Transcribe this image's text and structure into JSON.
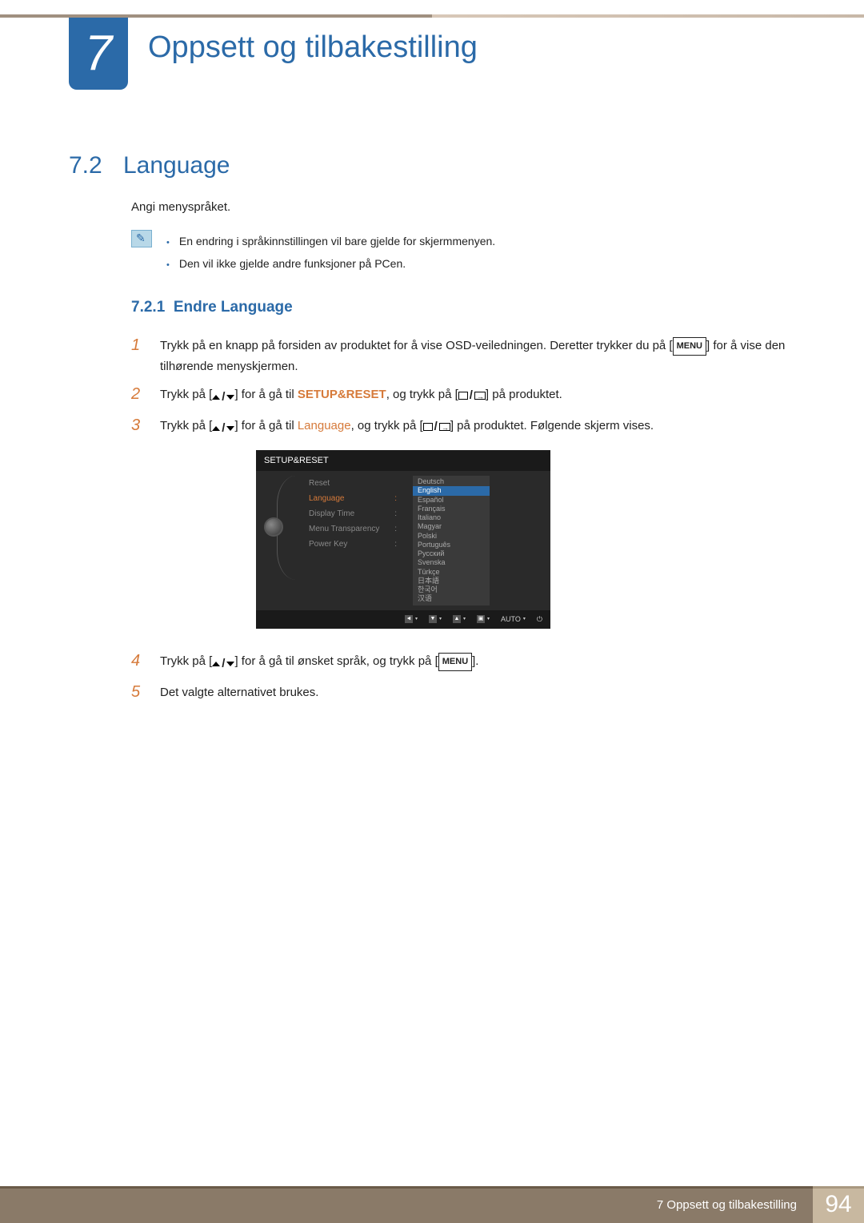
{
  "chapter": {
    "num": "7",
    "title": "Oppsett og tilbakestilling"
  },
  "section": {
    "num": "7.2",
    "title": "Language",
    "intro": "Angi menyspråket.",
    "notes": [
      "En endring i språkinnstillingen vil bare gjelde for skjermmenyen.",
      "Den vil ikke gjelde andre funksjoner på PCen."
    ]
  },
  "subsection": {
    "num": "7.2.1",
    "title": "Endre Language"
  },
  "steps": {
    "s1a": "Trykk på en knapp på forsiden av produktet for å vise OSD-veiledningen. Deretter trykker du på [",
    "s1b": "] for å vise den tilhørende menyskjermen.",
    "s2a": "Trykk på [",
    "s2b": "] for å gå til ",
    "s2c": ", og trykk på [",
    "s2d": "] på produktet.",
    "s3a": "Trykk på [",
    "s3b": "] for å gå til ",
    "s3c": ", og trykk på [",
    "s3d": "] på produktet. Følgende skjerm vises.",
    "s4a": "Trykk på [",
    "s4b": "] for å gå til ønsket språk, og trykk på [",
    "s4c": "].",
    "s5": "Det valgte alternativet brukes."
  },
  "labels": {
    "menu": "MENU",
    "setupreset": "SETUP&RESET",
    "language": "Language"
  },
  "osd": {
    "title": "SETUP&RESET",
    "menu": [
      "Reset",
      "Language",
      "Display Time",
      "Menu Transparency",
      "Power Key"
    ],
    "selected": "Language",
    "langs": [
      "Deutsch",
      "English",
      "Español",
      "Français",
      "Italiano",
      "Magyar",
      "Polski",
      "Português",
      "Русский",
      "Svenska",
      "Türkçe",
      "日本語",
      "한국어",
      "汉语"
    ],
    "highlighted": "English",
    "auto": "AUTO"
  },
  "footer": {
    "text": "7 Oppsett og tilbakestilling",
    "page": "94"
  }
}
